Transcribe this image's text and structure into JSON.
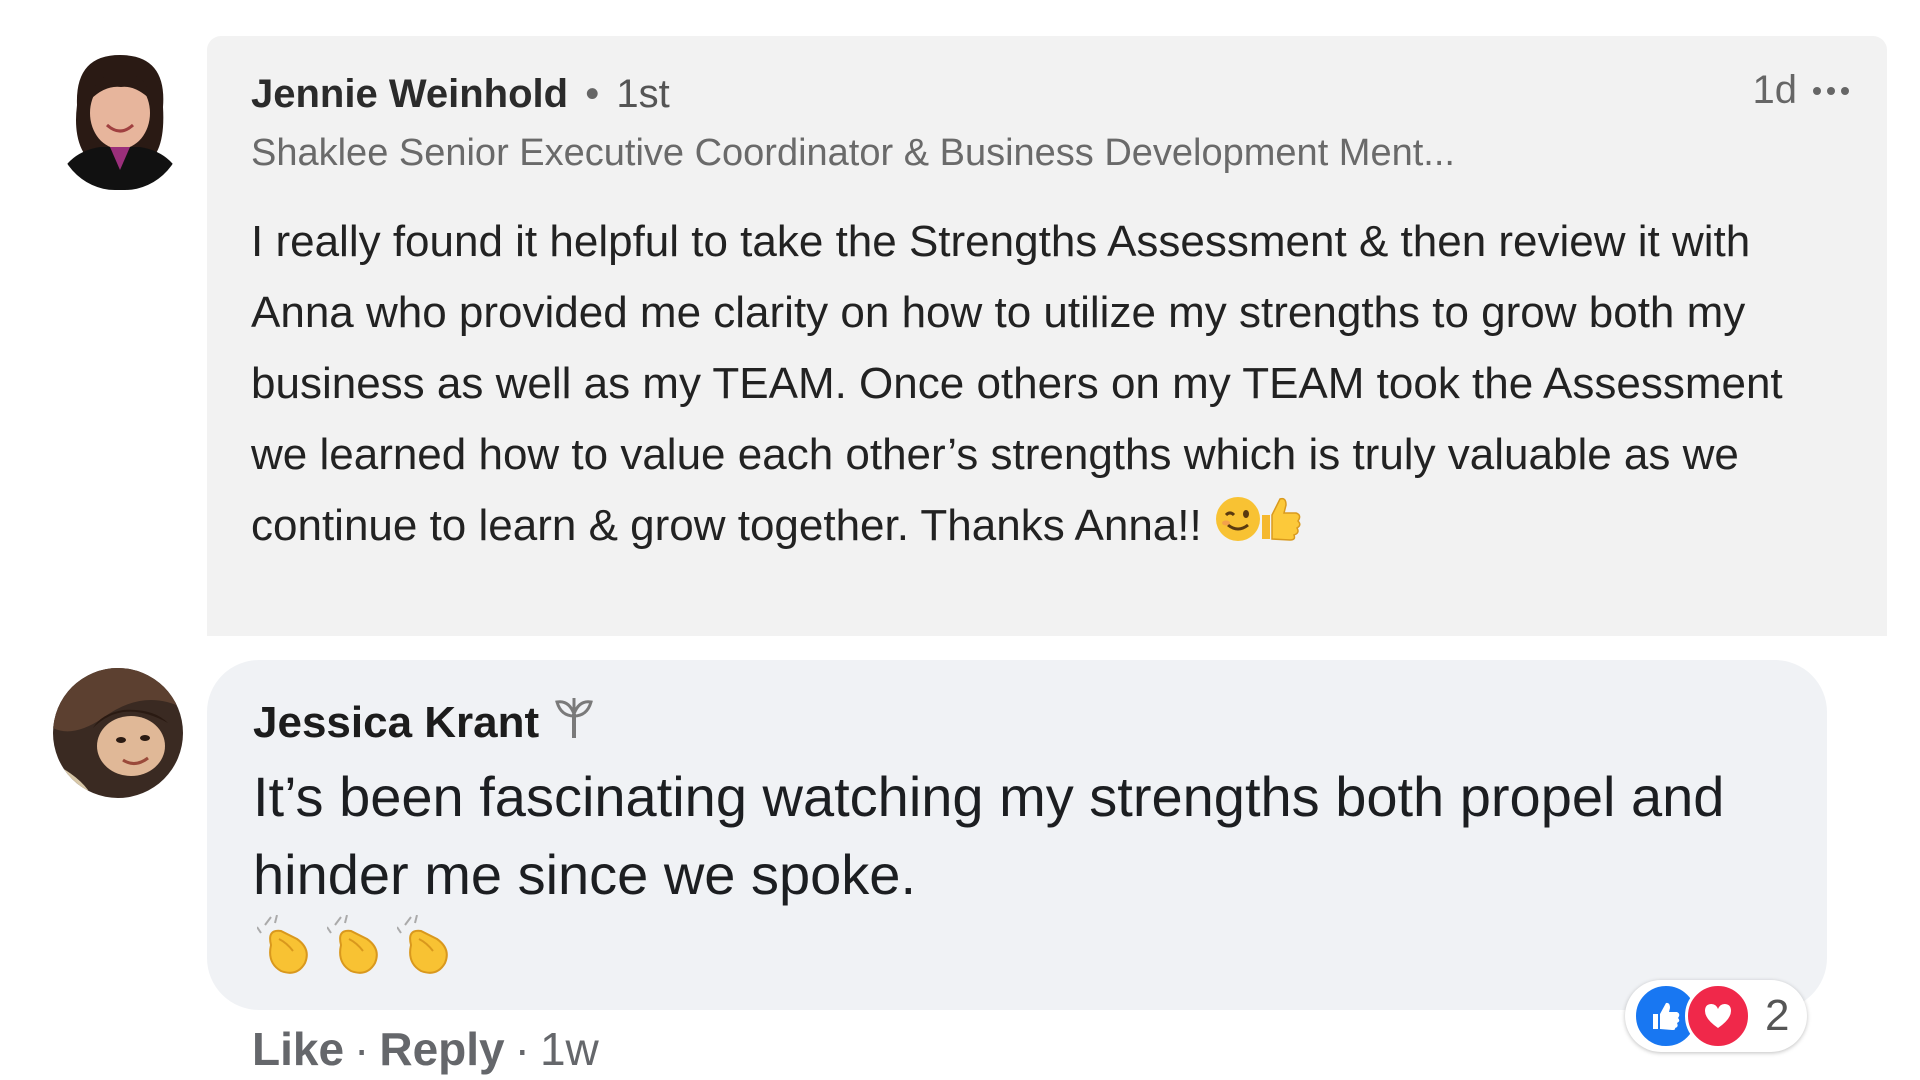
{
  "comments": [
    {
      "author": "Jennie Weinhold",
      "separator": "•",
      "connection": "1st",
      "headline": "Shaklee Senior Executive Coordinator & Business Development Ment...",
      "time": "1d",
      "body": "I really found it helpful to take the Strengths Assessment & then review it with Anna who provided me clarity on how to utilize my strengths to grow both my business as well as my TEAM. Once others on my TEAM took the Assessment we learned how to value each other’s strengths which is truly valuable as we continue to learn & grow together. Thanks Anna!!",
      "body_emoji": [
        "winking-face",
        "thumbs-up"
      ],
      "more_icon": "ellipsis-icon"
    },
    {
      "author": "Jessica Krant",
      "badge_icon": "plant-sprout-icon",
      "body": "It’s been fascinating watching my strengths both propel and hinder me since we spoke.",
      "body_emoji": [
        "clapping-hands",
        "clapping-hands",
        "clapping-hands"
      ],
      "reactions": {
        "icons": [
          "like-icon",
          "love-icon"
        ],
        "count": "2"
      },
      "actions": {
        "like": "Like",
        "reply": "Reply",
        "separator": "·",
        "time": "1w"
      }
    }
  ],
  "colors": {
    "card_bg": "#f2f2f2",
    "bubble_bg": "#f0f2f5",
    "like_blue": "#1877f2",
    "love_red": "#f0284a",
    "muted_text": "#65676b"
  }
}
